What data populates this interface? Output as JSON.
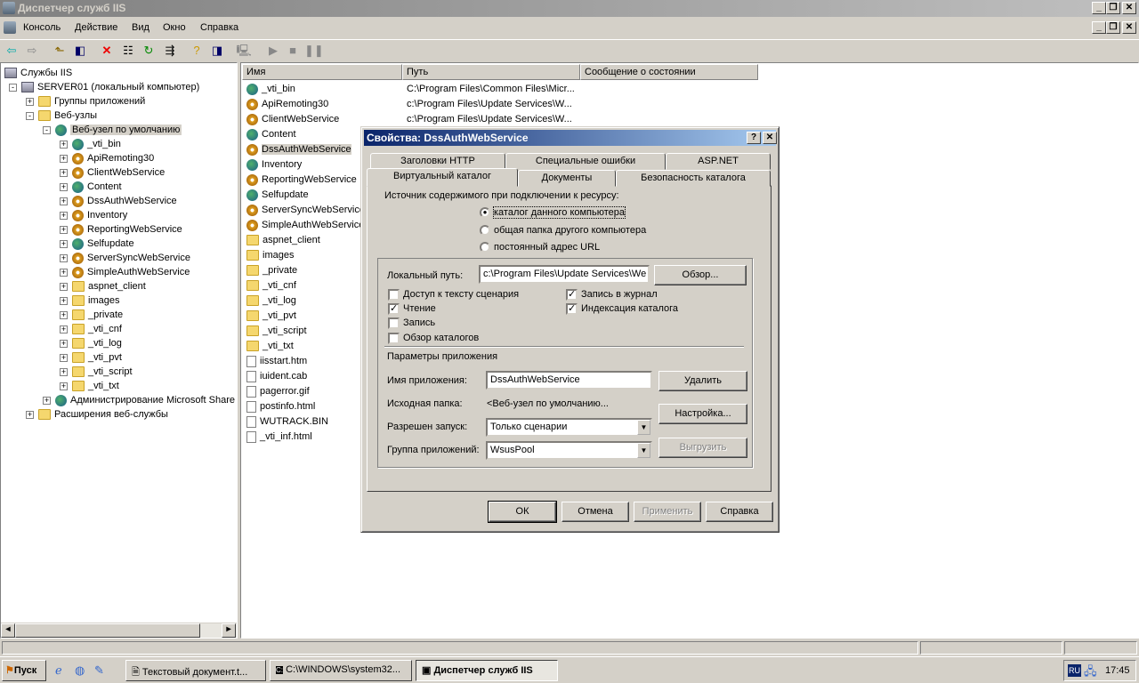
{
  "window": {
    "title": "Диспетчер служб IIS"
  },
  "menu": [
    "Консоль",
    "Действие",
    "Вид",
    "Окно",
    "Справка"
  ],
  "tree": [
    {
      "label": "Службы IIS",
      "level": 0,
      "icon": "iis-icon",
      "exp": ""
    },
    {
      "label": "SERVER01 (локальный компьютер)",
      "level": 1,
      "icon": "server",
      "exp": "-"
    },
    {
      "label": "Группы приложений",
      "level": 2,
      "icon": "folder",
      "exp": "+"
    },
    {
      "label": "Веб-узлы",
      "level": 2,
      "icon": "folder",
      "exp": "-"
    },
    {
      "label": "Веб-узел по умолчанию",
      "level": 3,
      "icon": "globe",
      "exp": "-",
      "selected": true
    },
    {
      "label": "_vti_bin",
      "level": 4,
      "icon": "globe",
      "exp": "+"
    },
    {
      "label": "ApiRemoting30",
      "level": 4,
      "icon": "gear",
      "exp": "+"
    },
    {
      "label": "ClientWebService",
      "level": 4,
      "icon": "gear",
      "exp": "+"
    },
    {
      "label": "Content",
      "level": 4,
      "icon": "globe",
      "exp": "+"
    },
    {
      "label": "DssAuthWebService",
      "level": 4,
      "icon": "gear",
      "exp": "+"
    },
    {
      "label": "Inventory",
      "level": 4,
      "icon": "gear",
      "exp": "+"
    },
    {
      "label": "ReportingWebService",
      "level": 4,
      "icon": "gear",
      "exp": "+"
    },
    {
      "label": "Selfupdate",
      "level": 4,
      "icon": "globe",
      "exp": "+"
    },
    {
      "label": "ServerSyncWebService",
      "level": 4,
      "icon": "gear",
      "exp": "+"
    },
    {
      "label": "SimpleAuthWebService",
      "level": 4,
      "icon": "gear",
      "exp": "+"
    },
    {
      "label": "aspnet_client",
      "level": 4,
      "icon": "folder",
      "exp": "+"
    },
    {
      "label": "images",
      "level": 4,
      "icon": "folder",
      "exp": "+"
    },
    {
      "label": "_private",
      "level": 4,
      "icon": "folder",
      "exp": "+"
    },
    {
      "label": "_vti_cnf",
      "level": 4,
      "icon": "folder",
      "exp": "+"
    },
    {
      "label": "_vti_log",
      "level": 4,
      "icon": "folder",
      "exp": "+"
    },
    {
      "label": "_vti_pvt",
      "level": 4,
      "icon": "folder",
      "exp": "+"
    },
    {
      "label": "_vti_script",
      "level": 4,
      "icon": "folder",
      "exp": "+"
    },
    {
      "label": "_vti_txt",
      "level": 4,
      "icon": "folder",
      "exp": "+"
    },
    {
      "label": "Администрирование Microsoft Share",
      "level": 3,
      "icon": "globe",
      "exp": "+"
    },
    {
      "label": "Расширения веб-службы",
      "level": 2,
      "icon": "folder",
      "exp": "+"
    }
  ],
  "list": {
    "columns": [
      "Имя",
      "Путь",
      "Сообщение о состоянии"
    ],
    "rows": [
      {
        "name": "_vti_bin",
        "path": "C:\\Program Files\\Common Files\\Micr...",
        "icon": "globe"
      },
      {
        "name": "ApiRemoting30",
        "path": "c:\\Program Files\\Update Services\\W...",
        "icon": "gear"
      },
      {
        "name": "ClientWebService",
        "path": "c:\\Program Files\\Update Services\\W...",
        "icon": "gear"
      },
      {
        "name": "Content",
        "path": "",
        "icon": "globe"
      },
      {
        "name": "DssAuthWebService",
        "path": "",
        "icon": "gear",
        "selected": true
      },
      {
        "name": "Inventory",
        "path": "",
        "icon": "globe"
      },
      {
        "name": "ReportingWebService",
        "path": "",
        "icon": "gear"
      },
      {
        "name": "Selfupdate",
        "path": "",
        "icon": "globe"
      },
      {
        "name": "ServerSyncWebService",
        "path": "",
        "icon": "gear"
      },
      {
        "name": "SimpleAuthWebService",
        "path": "",
        "icon": "gear"
      },
      {
        "name": "aspnet_client",
        "path": "",
        "icon": "folder"
      },
      {
        "name": "images",
        "path": "",
        "icon": "folder"
      },
      {
        "name": "_private",
        "path": "",
        "icon": "folder"
      },
      {
        "name": "_vti_cnf",
        "path": "",
        "icon": "folder"
      },
      {
        "name": "_vti_log",
        "path": "",
        "icon": "folder"
      },
      {
        "name": "_vti_pvt",
        "path": "",
        "icon": "folder"
      },
      {
        "name": "_vti_script",
        "path": "",
        "icon": "folder"
      },
      {
        "name": "_vti_txt",
        "path": "",
        "icon": "folder"
      },
      {
        "name": "iisstart.htm",
        "path": "",
        "icon": "file"
      },
      {
        "name": "iuident.cab",
        "path": "",
        "icon": "file"
      },
      {
        "name": "pagerror.gif",
        "path": "",
        "icon": "file"
      },
      {
        "name": "postinfo.html",
        "path": "",
        "icon": "file"
      },
      {
        "name": "WUTRACK.BIN",
        "path": "",
        "icon": "file"
      },
      {
        "name": "_vti_inf.html",
        "path": "",
        "icon": "file"
      }
    ]
  },
  "dialog": {
    "title": "Свойства: DssAuthWebService",
    "tabs_back": [
      "Заголовки HTTP",
      "Специальные ошибки",
      "ASP.NET"
    ],
    "tabs_front": [
      "Виртуальный каталог",
      "Документы",
      "Безопасность каталога"
    ],
    "source_label": "Источник содержимого при подключении к ресурсу:",
    "radios": [
      "каталог данного компьютера",
      "общая папка другого компьютера",
      "постоянный адрес URL"
    ],
    "local_path_label": "Локальный путь:",
    "local_path_value": "c:\\Program Files\\Update Services\\We",
    "browse": "Обзор...",
    "checks": [
      {
        "label": "Доступ к тексту сценария",
        "checked": false
      },
      {
        "label": "Чтение",
        "checked": true
      },
      {
        "label": "Запись",
        "checked": false
      },
      {
        "label": "Обзор каталогов",
        "checked": false
      },
      {
        "label": "Запись в журнал",
        "checked": true
      },
      {
        "label": "Индексация каталога",
        "checked": true
      }
    ],
    "app_params": "Параметры приложения",
    "app_name_label": "Имя приложения:",
    "app_name_value": "DssAuthWebService",
    "delete": "Удалить",
    "start_folder_label": "Исходная папка:",
    "start_folder_value": "<Веб-узел по умолчанию...",
    "configure": "Настройка...",
    "exec_label": "Разрешен запуск:",
    "exec_value": "Только сценарии",
    "unload": "Выгрузить",
    "pool_label": "Группа приложений:",
    "pool_value": "WsusPool",
    "ok": "ОК",
    "cancel": "Отмена",
    "apply": "Применить",
    "help": "Справка"
  },
  "taskbar": {
    "start": "Пуск",
    "tasks": [
      "Текстовый документ.t...",
      "C:\\WINDOWS\\system32...",
      "Диспетчер служб IIS"
    ],
    "lang": "RU",
    "time": "17:45"
  }
}
